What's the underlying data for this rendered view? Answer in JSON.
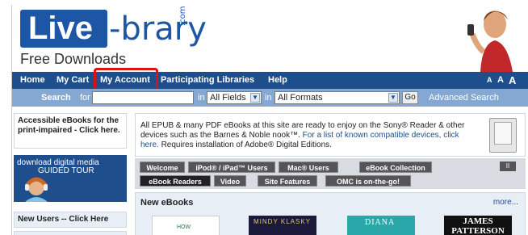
{
  "header": {
    "logo_live": "Live",
    "logo_rest": "-brary",
    "logo_com": ".com",
    "tagline": "Free Downloads"
  },
  "nav": {
    "items": [
      "Home",
      "My Cart",
      "My Account",
      "Participating Libraries",
      "Help"
    ],
    "text_size": [
      "A",
      "A",
      "A"
    ]
  },
  "search": {
    "label": "Search",
    "for_label": "for",
    "in_label_1": "in",
    "field_selected": "All Fields",
    "in_label_2": "in",
    "format_selected": "All Formats",
    "go_label": "Go",
    "advanced_label": "Advanced Search"
  },
  "left": {
    "accessible": "Accessible eBooks for the print-impaired - Click here.",
    "guide_line1": "download digital media",
    "guide_line2": "GUIDED TOUR",
    "new_users": "New Users -- Click Here"
  },
  "main": {
    "info_text": "All EPUB & many PDF eBooks at this site are ready to enjoy on the Sony® Reader & other devices such as the Barnes & Noble nook™.",
    "info_link": "For a list of known compatible devices, click here.",
    "info_tail": "Requires installation of Adobe® Digital Editions.",
    "tabs_row1": [
      "Welcome",
      "iPod® / iPad™ Users",
      "Mac® Users",
      "eBook Collection"
    ],
    "tabs_row2": [
      "eBook Readers",
      "Video",
      "Site Features",
      "OMC is on-the-go!"
    ],
    "pause_label": "II",
    "new_ebooks_title": "New eBooks",
    "more_label": "more...",
    "covers": [
      {
        "text": "HOW",
        "bg": "#ffffff",
        "fg": "#2c7a4b"
      },
      {
        "text": "MINDY KLASKY",
        "bg": "#1c1a3a",
        "fg": "#e2c36c"
      },
      {
        "text": "DIANA",
        "bg": "#2aa7a8",
        "fg": "#ffffff"
      },
      {
        "text": "JAMES PATTERSON",
        "bg": "#111111",
        "fg": "#ffffff"
      }
    ]
  },
  "colors": {
    "nav_bg": "#1f4e8c",
    "search_bg": "#84a8d2",
    "highlight": "#e01010"
  }
}
